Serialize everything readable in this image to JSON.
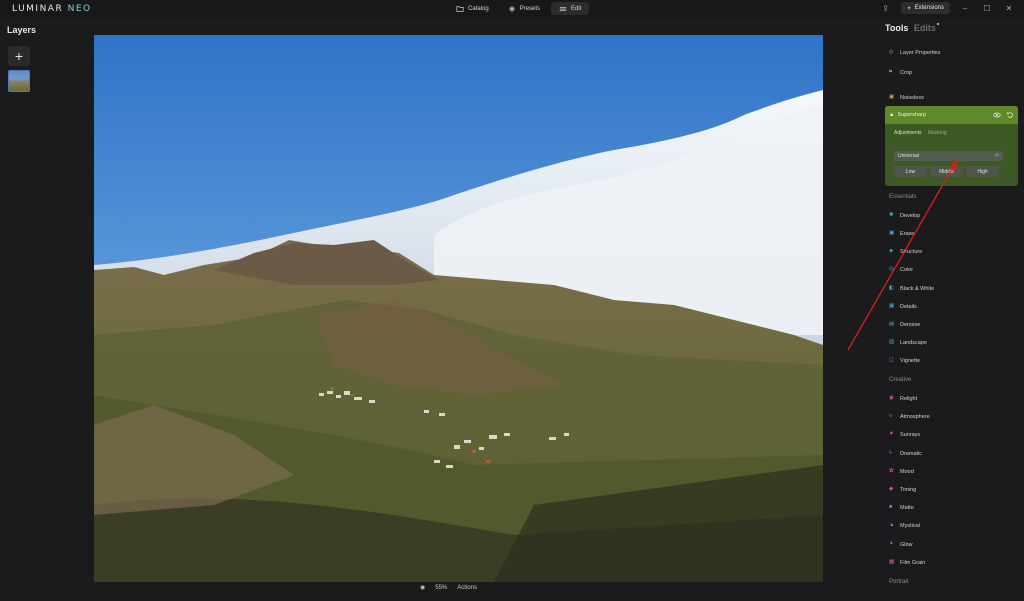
{
  "app": {
    "logo_main": "LUMINAR",
    "logo_accent": "NEO"
  },
  "modes": [
    {
      "label": "Catalog",
      "icon": "folder-icon"
    },
    {
      "label": "Presets",
      "icon": "sparkle-icon"
    },
    {
      "label": "Edit",
      "icon": "sliders-icon"
    }
  ],
  "window": {
    "extensions_label": "Extensions"
  },
  "layers": {
    "title": "Layers",
    "add_label": "+"
  },
  "bottom": {
    "zoom": "55%",
    "actions": "Actions"
  },
  "tools_panel": {
    "tab_tools": "Tools",
    "tab_edits": "Edits",
    "layer_properties": "Layer Properties",
    "crop": "Crop",
    "noiseless": "Noiseless",
    "supersharp": {
      "title": "Supersharp",
      "tab_adjustments": "Adjustments",
      "tab_masking": "Masking",
      "mode_value": "Universal",
      "buttons": [
        "Low",
        "Middle",
        "High"
      ]
    },
    "essentials_heading": "Essentials",
    "essentials": [
      "Develop",
      "Erase",
      "Structure",
      "Color",
      "Black & White",
      "Details",
      "Denoise",
      "Landscape",
      "Vignette"
    ],
    "creative_heading": "Creative",
    "creative": [
      "Relight",
      "Atmosphere",
      "Sunrays",
      "Dramatic",
      "Mood",
      "Toning",
      "Matte",
      "Mystical",
      "Glow",
      "Film Grain"
    ],
    "portrait_heading": "Portrait"
  },
  "colors": {
    "accent_green": "#5e8a2a",
    "arrow_red": "#d42020",
    "selection_blue": "#4a7ab8"
  }
}
